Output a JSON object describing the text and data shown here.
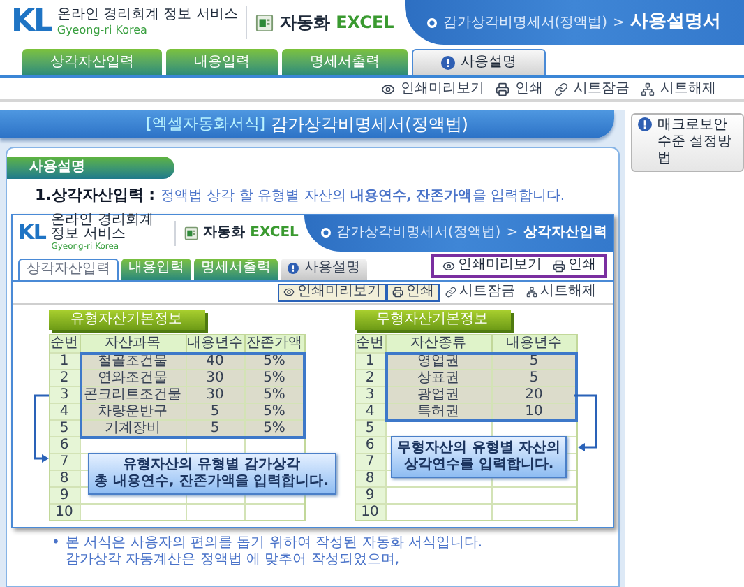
{
  "header": {
    "logo": "KL",
    "service": "온라인 경리회계 정보 서비스",
    "service_en": "Gyeong-ri Korea",
    "product_ko": "자동화",
    "product_en": "EXCEL",
    "breadcrumb": "감가상각비명세서(정액법)",
    "separator": ">",
    "page": "사용설명서"
  },
  "tabs": [
    {
      "label": "상각자산입력",
      "kind": "main",
      "selected": false
    },
    {
      "label": "내용입력",
      "kind": "main",
      "selected": false
    },
    {
      "label": "명세서출력",
      "kind": "main",
      "selected": false
    },
    {
      "label": "사용설명",
      "kind": "help",
      "selected": true
    }
  ],
  "toolbar": [
    "인쇄미리보기",
    "인쇄",
    "시트잠금",
    "시트해제"
  ],
  "macro_button": "매크로보안수준 설정방법",
  "banner": {
    "prefix": "[엑셀자동화서식]",
    "title": "감가상각비명세서(정액법)"
  },
  "section_title": "사용설명",
  "step": {
    "title": "1.상각자산입력 :",
    "description": "정액법 상각 할 유형별 자산의 **내용연수, 잔존가액**을 입력합니다."
  },
  "example": {
    "header": {
      "logo": "KL",
      "service": "온라인 경리회계 정보 서비스",
      "service_en": "Gyeong-ri Korea",
      "product_ko": "자동화",
      "product_en": "EXCEL",
      "breadcrumb": "감가상각비명세서(정액법)",
      "separator": ">",
      "page": "상각자산입력"
    },
    "tabs": [
      {
        "label": "상각자산입력",
        "kind": "main",
        "selected": true
      },
      {
        "label": "내용입력",
        "kind": "main",
        "selected": false
      },
      {
        "label": "명세서출력",
        "kind": "main",
        "selected": false
      },
      {
        "label": "사용설명",
        "kind": "help",
        "selected": false
      }
    ],
    "callout_buttons": [
      "인쇄미리보기",
      "인쇄"
    ],
    "toolbar": [
      {
        "label": "인쇄미리보기",
        "highlighted": true
      },
      {
        "label": "인쇄",
        "highlighted": true
      },
      {
        "label": "시트잠금",
        "highlighted": false
      },
      {
        "label": "시트해제",
        "highlighted": false
      }
    ],
    "tables": [
      {
        "title": "유형자산기본정보",
        "columns": [
          "순번",
          "자산과목",
          "내용년수",
          "잔존가액"
        ],
        "callout": [
          "유형자산의 유형별 감가상각",
          "총 내용연수, 잔존가액을 입력합니다."
        ],
        "rows": [
          [
            "1",
            "철골조건물",
            "40",
            "5%"
          ],
          [
            "2",
            "연와조건물",
            "30",
            "5%"
          ],
          [
            "3",
            "콘크리트조건물",
            "30",
            "5%"
          ],
          [
            "4",
            "차량운반구",
            "5",
            "5%"
          ],
          [
            "5",
            "기계장비",
            "5",
            "5%"
          ],
          [
            "6"
          ],
          [
            "7"
          ],
          [
            "8"
          ],
          [
            "9"
          ],
          [
            "10"
          ]
        ]
      },
      {
        "title": "무형자산기본정보",
        "columns": [
          "순번",
          "자산종류",
          "내용년수"
        ],
        "callout": [
          "무형자산의 유형별 자산의",
          "상각연수를 입력합니다."
        ],
        "rows": [
          [
            "1",
            "영업권",
            "5"
          ],
          [
            "2",
            "상표권",
            "5"
          ],
          [
            "3",
            "광업권",
            "20"
          ],
          [
            "4",
            "특허권",
            "10"
          ],
          [
            "5"
          ],
          [
            "6"
          ],
          [
            "7"
          ],
          [
            "8"
          ],
          [
            "9"
          ],
          [
            "10"
          ]
        ]
      }
    ]
  },
  "notes": {
    "bullet": "•",
    "lines": [
      "본 서식은 사용자의 편의를 돕기 위하여 작성된 자동화 서식입니다.",
      "감가상각 자동계산은 정액법 에 맞추어 작성되었으며,"
    ]
  }
}
